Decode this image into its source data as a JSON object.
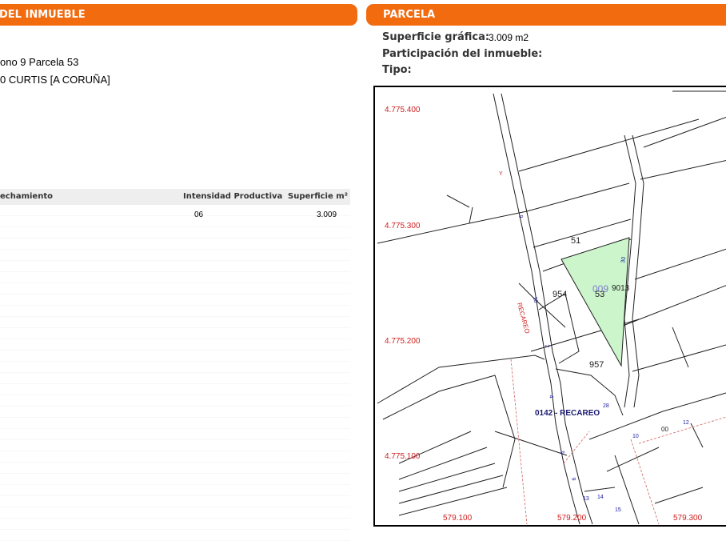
{
  "left_header": "DEL INMUEBLE",
  "right_header": "PARCELA",
  "location": {
    "line1": "ono 9 Parcela 53",
    "line2": "0 CURTIS [A CORUÑA]"
  },
  "parcel_info": {
    "surface_label": "Superficie gráfica:",
    "surface_value": "3.009 m2",
    "participation_label": "Participación del inmueble:",
    "type_label": "Tipo:"
  },
  "table": {
    "headers": [
      "echamiento",
      "Intensidad Productiva",
      "Superficie m²"
    ],
    "rows": [
      {
        "intensity": "06",
        "surface": "3.009"
      }
    ]
  },
  "map": {
    "y_coords": [
      "4.775.400",
      "4.775.300",
      "4.775.200",
      "4.775.100"
    ],
    "x_coords": [
      "579.100",
      "579.200",
      "579.300"
    ],
    "highlight_parcel": "009",
    "parcel_labels": [
      "51",
      "53",
      "954",
      "9013",
      "957",
      "00"
    ],
    "place_label": "0142 - RECAREO",
    "road_label": "RECAREO",
    "accent_color": "#f26b0f",
    "parcel_fill": "#ccf5cc",
    "coord_color": "#d02020",
    "road_number_color": "#1a1aa0"
  }
}
